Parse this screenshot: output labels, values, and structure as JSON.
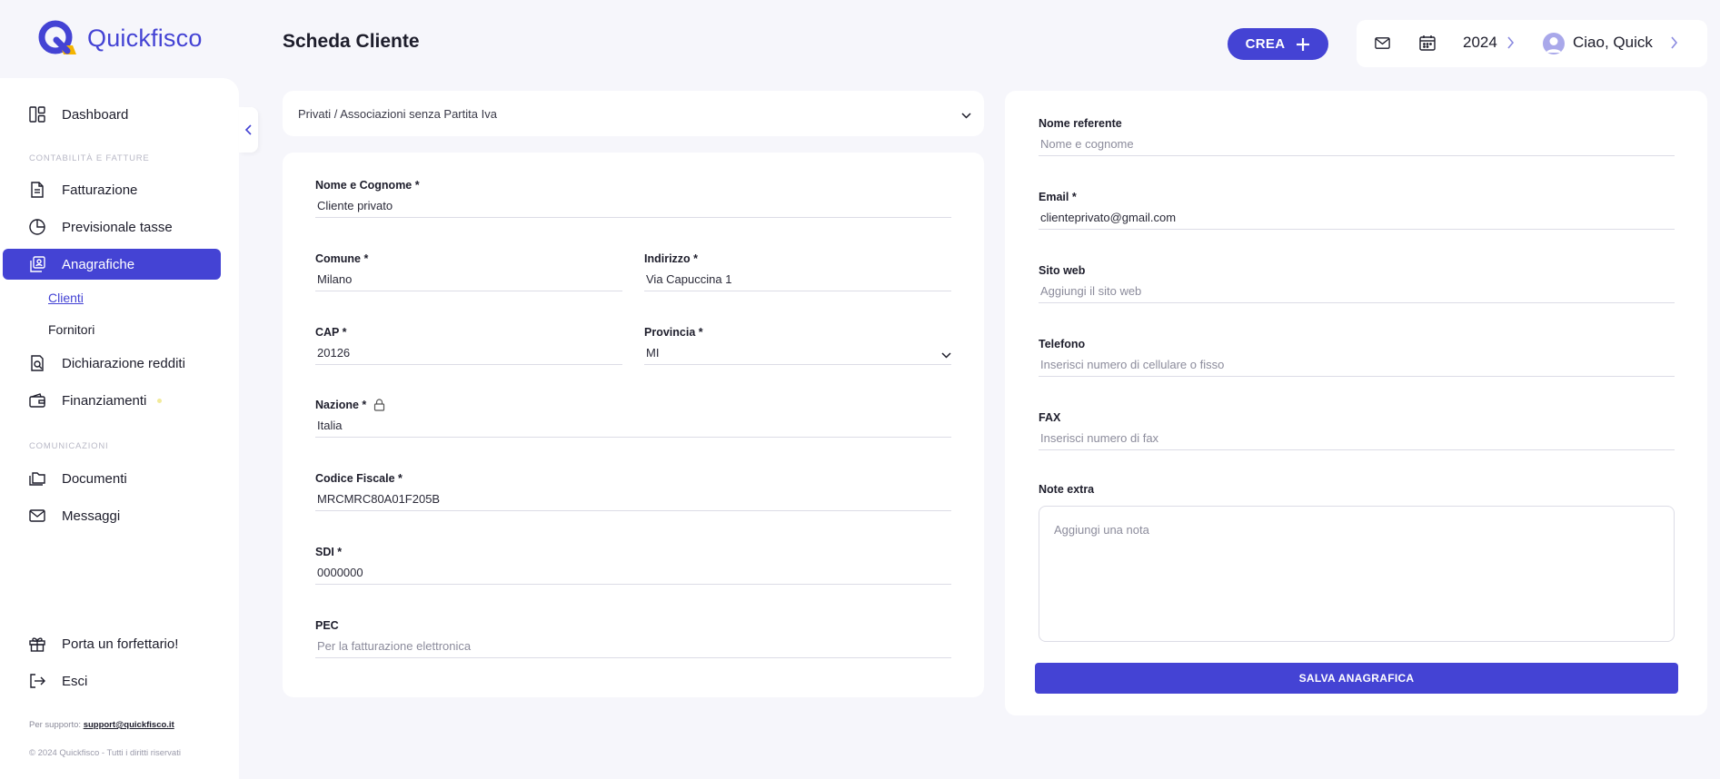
{
  "app": {
    "logo_text": "Quickfisco",
    "brand_color": "#4443d4"
  },
  "sidebar": {
    "items": [
      {
        "label": "Dashboard",
        "icon": "dashboard-icon"
      },
      {
        "label": "Fatturazione",
        "icon": "document-icon"
      },
      {
        "label": "Previsionale tasse",
        "icon": "pie-chart-icon"
      },
      {
        "label": "Anagrafiche",
        "icon": "contacts-icon",
        "active": true
      },
      {
        "label": "Dichiarazione redditi",
        "icon": "tax-declaration-icon"
      },
      {
        "label": "Finanziamenti",
        "icon": "wallet-icon"
      },
      {
        "label": "Documenti",
        "icon": "folder-icon"
      },
      {
        "label": "Messaggi",
        "icon": "mail-icon"
      },
      {
        "label": "Porta un forfettario!",
        "icon": "gift-icon"
      },
      {
        "label": "Esci",
        "icon": "logout-icon"
      }
    ],
    "sections": [
      "CONTABILITÀ E FATTURE",
      "COMUNICAZIONI"
    ],
    "subitems": [
      {
        "label": "Clienti",
        "active": true
      },
      {
        "label": "Fornitori"
      }
    ],
    "support_prefix": "Per supporto:",
    "support_email": "support@quickfisco.it",
    "copyright": "© 2024 Quickfisco - Tutti i diritti riservati"
  },
  "header": {
    "title": "Scheda Cliente",
    "create_label": "CREA",
    "year": "2024",
    "greeting": "Ciao, Quick"
  },
  "client_type": {
    "selected": "Privati / Associazioni senza Partita Iva"
  },
  "form_left": {
    "nome_cognome": {
      "label": "Nome e Cognome *",
      "value": "Cliente privato"
    },
    "comune": {
      "label": "Comune *",
      "value": "Milano"
    },
    "indirizzo": {
      "label": "Indirizzo *",
      "value": "Via Capuccina 1"
    },
    "cap": {
      "label": "CAP *",
      "value": "20126"
    },
    "provincia": {
      "label": "Provincia *",
      "value": "MI"
    },
    "nazione": {
      "label": "Nazione *",
      "value": "Italia"
    },
    "codice_fiscale": {
      "label": "Codice Fiscale *",
      "value": "MRCMRC80A01F205B"
    },
    "sdi": {
      "label": "SDI *",
      "value": "0000000"
    },
    "pec": {
      "label": "PEC",
      "placeholder": "Per la fatturazione elettronica"
    }
  },
  "form_right": {
    "referente": {
      "label": "Nome referente",
      "placeholder": "Nome e cognome"
    },
    "email": {
      "label": "Email *",
      "value": "clienteprivato@gmail.com"
    },
    "sito": {
      "label": "Sito web",
      "placeholder": "Aggiungi il sito web"
    },
    "telefono": {
      "label": "Telefono",
      "placeholder": "Inserisci numero di cellulare o fisso"
    },
    "fax": {
      "label": "FAX",
      "placeholder": "Inserisci numero di fax"
    },
    "note": {
      "label": "Note extra",
      "placeholder": "Aggiungi una nota"
    },
    "save_label": "SALVA ANAGRAFICA"
  }
}
